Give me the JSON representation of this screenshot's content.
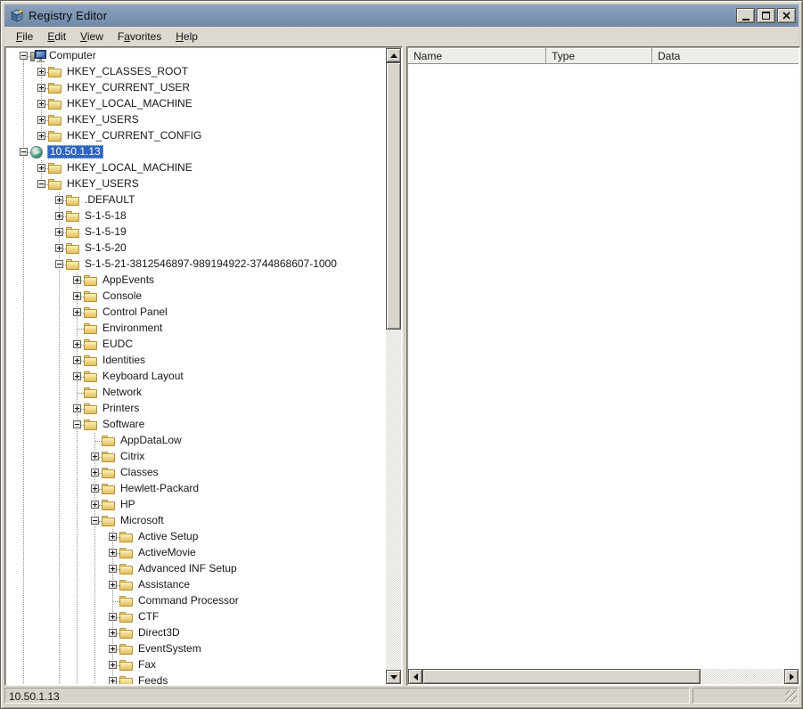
{
  "window": {
    "title": "Registry Editor",
    "controls": [
      {
        "name": "minimize-button"
      },
      {
        "name": "maximize-button"
      },
      {
        "name": "close-button"
      }
    ]
  },
  "menu": {
    "items": [
      {
        "label": "File",
        "accel_index": 0
      },
      {
        "label": "Edit",
        "accel_index": 0
      },
      {
        "label": "View",
        "accel_index": 0
      },
      {
        "label": "Favorites",
        "accel_index": 1
      },
      {
        "label": "Help",
        "accel_index": 0
      }
    ]
  },
  "list": {
    "columns": [
      "Name",
      "Type",
      "Data"
    ],
    "rows": []
  },
  "status": {
    "text": "10.50.1.13",
    "side_text": ""
  },
  "colors": {
    "titlebar": "#7C95B2",
    "selection": "#2E65BE",
    "folder": "#F0D98C",
    "panel_bg": "#FFFFFF",
    "chrome": "#D7D3CB"
  },
  "tree": [
    {
      "label": "Computer",
      "icon": "computer",
      "expand": "minus",
      "children": [
        {
          "label": "HKEY_CLASSES_ROOT",
          "icon": "folder",
          "expand": "plus"
        },
        {
          "label": "HKEY_CURRENT_USER",
          "icon": "folder",
          "expand": "plus"
        },
        {
          "label": "HKEY_LOCAL_MACHINE",
          "icon": "folder",
          "expand": "plus"
        },
        {
          "label": "HKEY_USERS",
          "icon": "folder",
          "expand": "plus"
        },
        {
          "label": "HKEY_CURRENT_CONFIG",
          "icon": "folder",
          "expand": "plus"
        }
      ]
    },
    {
      "label": "10.50.1.13",
      "icon": "globe",
      "expand": "minus",
      "selected": true,
      "moreBelow": true,
      "children": [
        {
          "label": "HKEY_LOCAL_MACHINE",
          "icon": "folder",
          "expand": "plus"
        },
        {
          "label": "HKEY_USERS",
          "icon": "folder",
          "expand": "minus",
          "children": [
            {
              "label": ".DEFAULT",
              "icon": "folder",
              "expand": "plus"
            },
            {
              "label": "S-1-5-18",
              "icon": "folder",
              "expand": "plus"
            },
            {
              "label": "S-1-5-19",
              "icon": "folder",
              "expand": "plus"
            },
            {
              "label": "S-1-5-20",
              "icon": "folder",
              "expand": "plus"
            },
            {
              "label": "S-1-5-21-3812546897-989194922-3744868607-1000",
              "icon": "folder",
              "expand": "minus",
              "moreBelow": true,
              "children": [
                {
                  "label": "AppEvents",
                  "icon": "folder",
                  "expand": "plus"
                },
                {
                  "label": "Console",
                  "icon": "folder",
                  "expand": "plus"
                },
                {
                  "label": "Control Panel",
                  "icon": "folder",
                  "expand": "plus"
                },
                {
                  "label": "Environment",
                  "icon": "folder",
                  "expand": "none"
                },
                {
                  "label": "EUDC",
                  "icon": "folder",
                  "expand": "plus"
                },
                {
                  "label": "Identities",
                  "icon": "folder",
                  "expand": "plus"
                },
                {
                  "label": "Keyboard Layout",
                  "icon": "folder",
                  "expand": "plus"
                },
                {
                  "label": "Network",
                  "icon": "folder",
                  "expand": "none"
                },
                {
                  "label": "Printers",
                  "icon": "folder",
                  "expand": "plus"
                },
                {
                  "label": "Software",
                  "icon": "folder",
                  "expand": "minus",
                  "moreBelow": true,
                  "children": [
                    {
                      "label": "AppDataLow",
                      "icon": "folder",
                      "expand": "none"
                    },
                    {
                      "label": "Citrix",
                      "icon": "folder",
                      "expand": "plus"
                    },
                    {
                      "label": "Classes",
                      "icon": "folder",
                      "expand": "plus"
                    },
                    {
                      "label": "Hewlett-Packard",
                      "icon": "folder",
                      "expand": "plus"
                    },
                    {
                      "label": "HP",
                      "icon": "folder",
                      "expand": "plus"
                    },
                    {
                      "label": "Microsoft",
                      "icon": "folder",
                      "expand": "minus",
                      "moreBelow": true,
                      "children": [
                        {
                          "label": "Active Setup",
                          "icon": "folder",
                          "expand": "plus"
                        },
                        {
                          "label": "ActiveMovie",
                          "icon": "folder",
                          "expand": "plus"
                        },
                        {
                          "label": "Advanced INF Setup",
                          "icon": "folder",
                          "expand": "plus"
                        },
                        {
                          "label": "Assistance",
                          "icon": "folder",
                          "expand": "plus"
                        },
                        {
                          "label": "Command Processor",
                          "icon": "folder",
                          "expand": "none"
                        },
                        {
                          "label": "CTF",
                          "icon": "folder",
                          "expand": "plus"
                        },
                        {
                          "label": "Direct3D",
                          "icon": "folder",
                          "expand": "plus"
                        },
                        {
                          "label": "EventSystem",
                          "icon": "folder",
                          "expand": "plus"
                        },
                        {
                          "label": "Fax",
                          "icon": "folder",
                          "expand": "plus"
                        },
                        {
                          "label": "Feeds",
                          "icon": "folder",
                          "expand": "plus",
                          "moreBelow": true
                        }
                      ]
                    }
                  ]
                }
              ]
            }
          ]
        }
      ]
    }
  ]
}
